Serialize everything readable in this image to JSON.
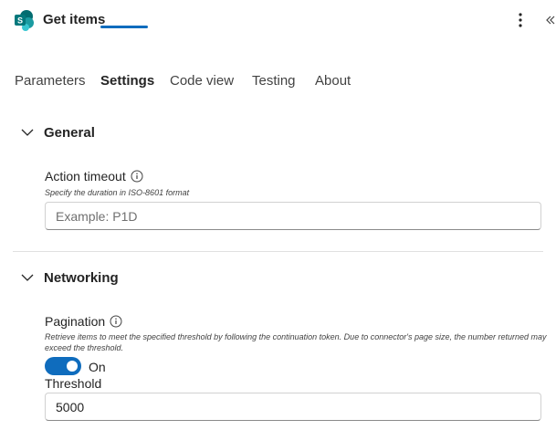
{
  "header": {
    "title": "Get items",
    "app_icon": "sharepoint-icon",
    "app_icon_letter": "S",
    "more_icon": "more-vertical-icon",
    "collapse_icon": "double-chevron-left-icon"
  },
  "tabs": [
    {
      "label": "Parameters",
      "active": false
    },
    {
      "label": "Settings",
      "active": true
    },
    {
      "label": "Code view",
      "active": false
    },
    {
      "label": "Testing",
      "active": false
    },
    {
      "label": "About",
      "active": false
    }
  ],
  "sections": {
    "general": {
      "title": "General",
      "expanded": true,
      "action_timeout": {
        "label": "Action timeout",
        "description": "Specify the duration in ISO-8601 format",
        "placeholder": "Example: P1D",
        "value": ""
      }
    },
    "networking": {
      "title": "Networking",
      "expanded": true,
      "pagination": {
        "label": "Pagination",
        "description": "Retrieve items to meet the specified threshold by following the continuation token. Due to connector's page size, the number returned may exceed the threshold.",
        "toggle_state": "On",
        "enabled": true
      },
      "threshold": {
        "label": "Threshold",
        "value": "5000"
      }
    }
  },
  "colors": {
    "accent": "#0f6cbd",
    "sharepoint_dark": "#036c70",
    "sharepoint_mid": "#1a9ba1",
    "sharepoint_light": "#37c6d0"
  }
}
